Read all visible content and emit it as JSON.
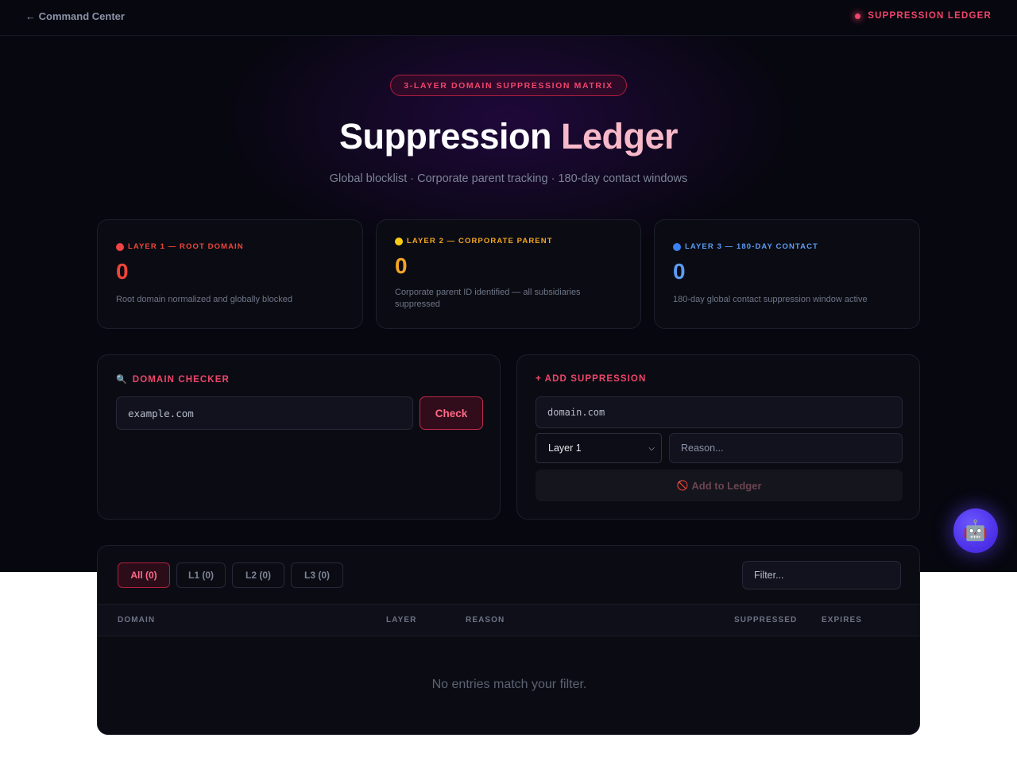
{
  "nav": {
    "back_label": "← Command Center",
    "brand_label": "SUPPRESSION LEDGER"
  },
  "hero": {
    "badge": "3-LAYER DOMAIN SUPPRESSION MATRIX",
    "title_part1": "Suppression",
    "title_part2": "Ledger",
    "subtitle": "Global blocklist · Corporate parent tracking · 180-day contact windows"
  },
  "layers": [
    {
      "label": "LAYER 1 — ROOT DOMAIN",
      "count": "0",
      "description": "Root domain normalized and globally blocked",
      "color": "#f0453a",
      "dot_color": "#ef4444"
    },
    {
      "label": "LAYER 2 — CORPORATE PARENT",
      "count": "0",
      "description": "Corporate parent ID identified — all subsidiaries suppressed",
      "color": "#f5a524",
      "dot_color": "#facc15"
    },
    {
      "label": "LAYER 3 — 180-DAY CONTACT",
      "count": "0",
      "description": "180-day global contact suppression window active",
      "color": "#5b9cf5",
      "dot_color": "#3b82f6"
    }
  ],
  "checker": {
    "title": "DOMAIN CHECKER",
    "icon": "magnifier-icon",
    "input_value": "example.com",
    "button_label": "Check"
  },
  "add_suppression": {
    "title": "+ ADD SUPPRESSION",
    "domain_value": "domain.com",
    "layer_selected": "Layer 1",
    "reason_placeholder": "Reason...",
    "button_label": "Add to Ledger",
    "button_icon": "🚫"
  },
  "table": {
    "tabs": [
      {
        "label": "All (0)",
        "active": true
      },
      {
        "label": "L1 (0)",
        "active": false
      },
      {
        "label": "L2 (0)",
        "active": false
      },
      {
        "label": "L3 (0)",
        "active": false
      }
    ],
    "filter_placeholder": "Filter...",
    "columns": [
      "DOMAIN",
      "LAYER",
      "REASON",
      "SUPPRESSED",
      "EXPIRES"
    ],
    "empty_message": "No entries match your filter."
  },
  "assistant": {
    "icon": "robot-icon",
    "glyph": "🤖"
  }
}
